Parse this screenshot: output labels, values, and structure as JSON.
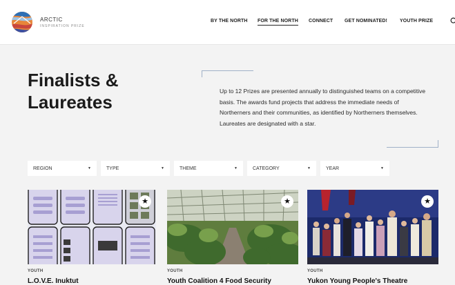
{
  "brand": {
    "name": "ARCTIC",
    "subtitle": "INSPIRATION PRIZE"
  },
  "nav": {
    "items": [
      {
        "label": "BY THE NORTH"
      },
      {
        "label": "FOR THE NORTH"
      },
      {
        "label": "CONNECT"
      },
      {
        "label": "GET NOMINATED!"
      },
      {
        "label": "YOUTH PRIZE"
      }
    ],
    "active": "FOR THE NORTH"
  },
  "page": {
    "title_line1": "Finalists &",
    "title_line2": "Laureates",
    "intro": "Up to 12 Prizes are presented annually to distinguished teams on a competitive basis. The awards fund projects that address the immediate needs of Northerners and their communities, as identified by Northerners themselves. Laureates are designated with a star."
  },
  "filters": [
    {
      "label": "REGION"
    },
    {
      "label": "TYPE"
    },
    {
      "label": "THEME"
    },
    {
      "label": "CATEGORY"
    },
    {
      "label": "YEAR"
    }
  ],
  "cards": [
    {
      "category": "YOUTH",
      "title": "L.O.V.E. Inuktut",
      "laureate": true,
      "star": "★",
      "image_icon": "app-screens-image"
    },
    {
      "category": "YOUTH",
      "title": "Youth Coalition 4 Food Security",
      "laureate": true,
      "star": "★",
      "image_icon": "greenhouse-image"
    },
    {
      "category": "YOUTH",
      "title": "Yukon Young People's Theatre",
      "laureate": true,
      "star": "★",
      "image_icon": "theatre-stage-image"
    }
  ],
  "colors": {
    "accent_line": "#9fb0c7",
    "header_bg": "#ffffff",
    "page_bg": "#f3f3f3"
  }
}
